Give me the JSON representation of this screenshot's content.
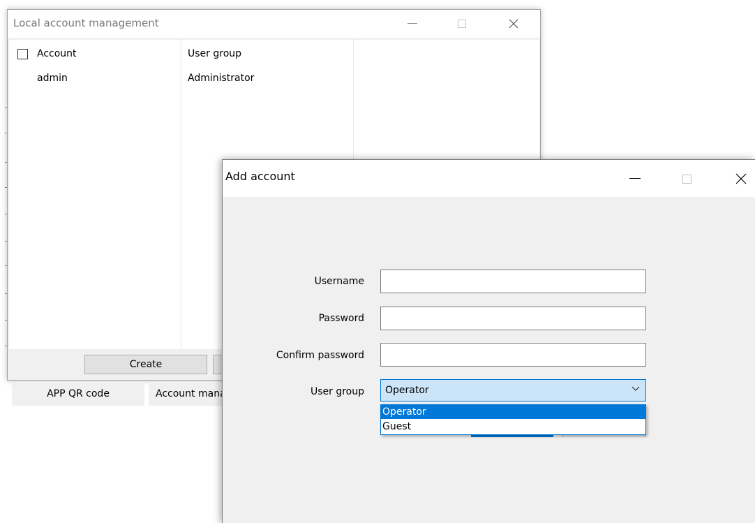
{
  "bg_window": {
    "title": "Local account management",
    "columns": {
      "account": "Account",
      "user_group": "User group"
    },
    "rows": [
      {
        "account": "admin",
        "user_group": "Administrator"
      }
    ],
    "create_label": "Create"
  },
  "tabs": {
    "app_qr": "APP QR code",
    "account_management": "Account management"
  },
  "add_window": {
    "title": "Add account",
    "username_label": "Username",
    "username_value": "",
    "password_label": "Password",
    "password_value": "",
    "confirm_label": "Confirm password",
    "confirm_value": "",
    "user_group_label": "User group",
    "user_group_selected": "Operator",
    "user_group_options": [
      "Operator",
      "Guest"
    ]
  },
  "colors": {
    "accent": "#0078d7",
    "selection_bg": "#cce4f7",
    "window_bg": "#f0f0f0"
  },
  "icons": [
    "minimize-icon",
    "maximize-icon",
    "close-icon",
    "chevron-down-icon"
  ]
}
